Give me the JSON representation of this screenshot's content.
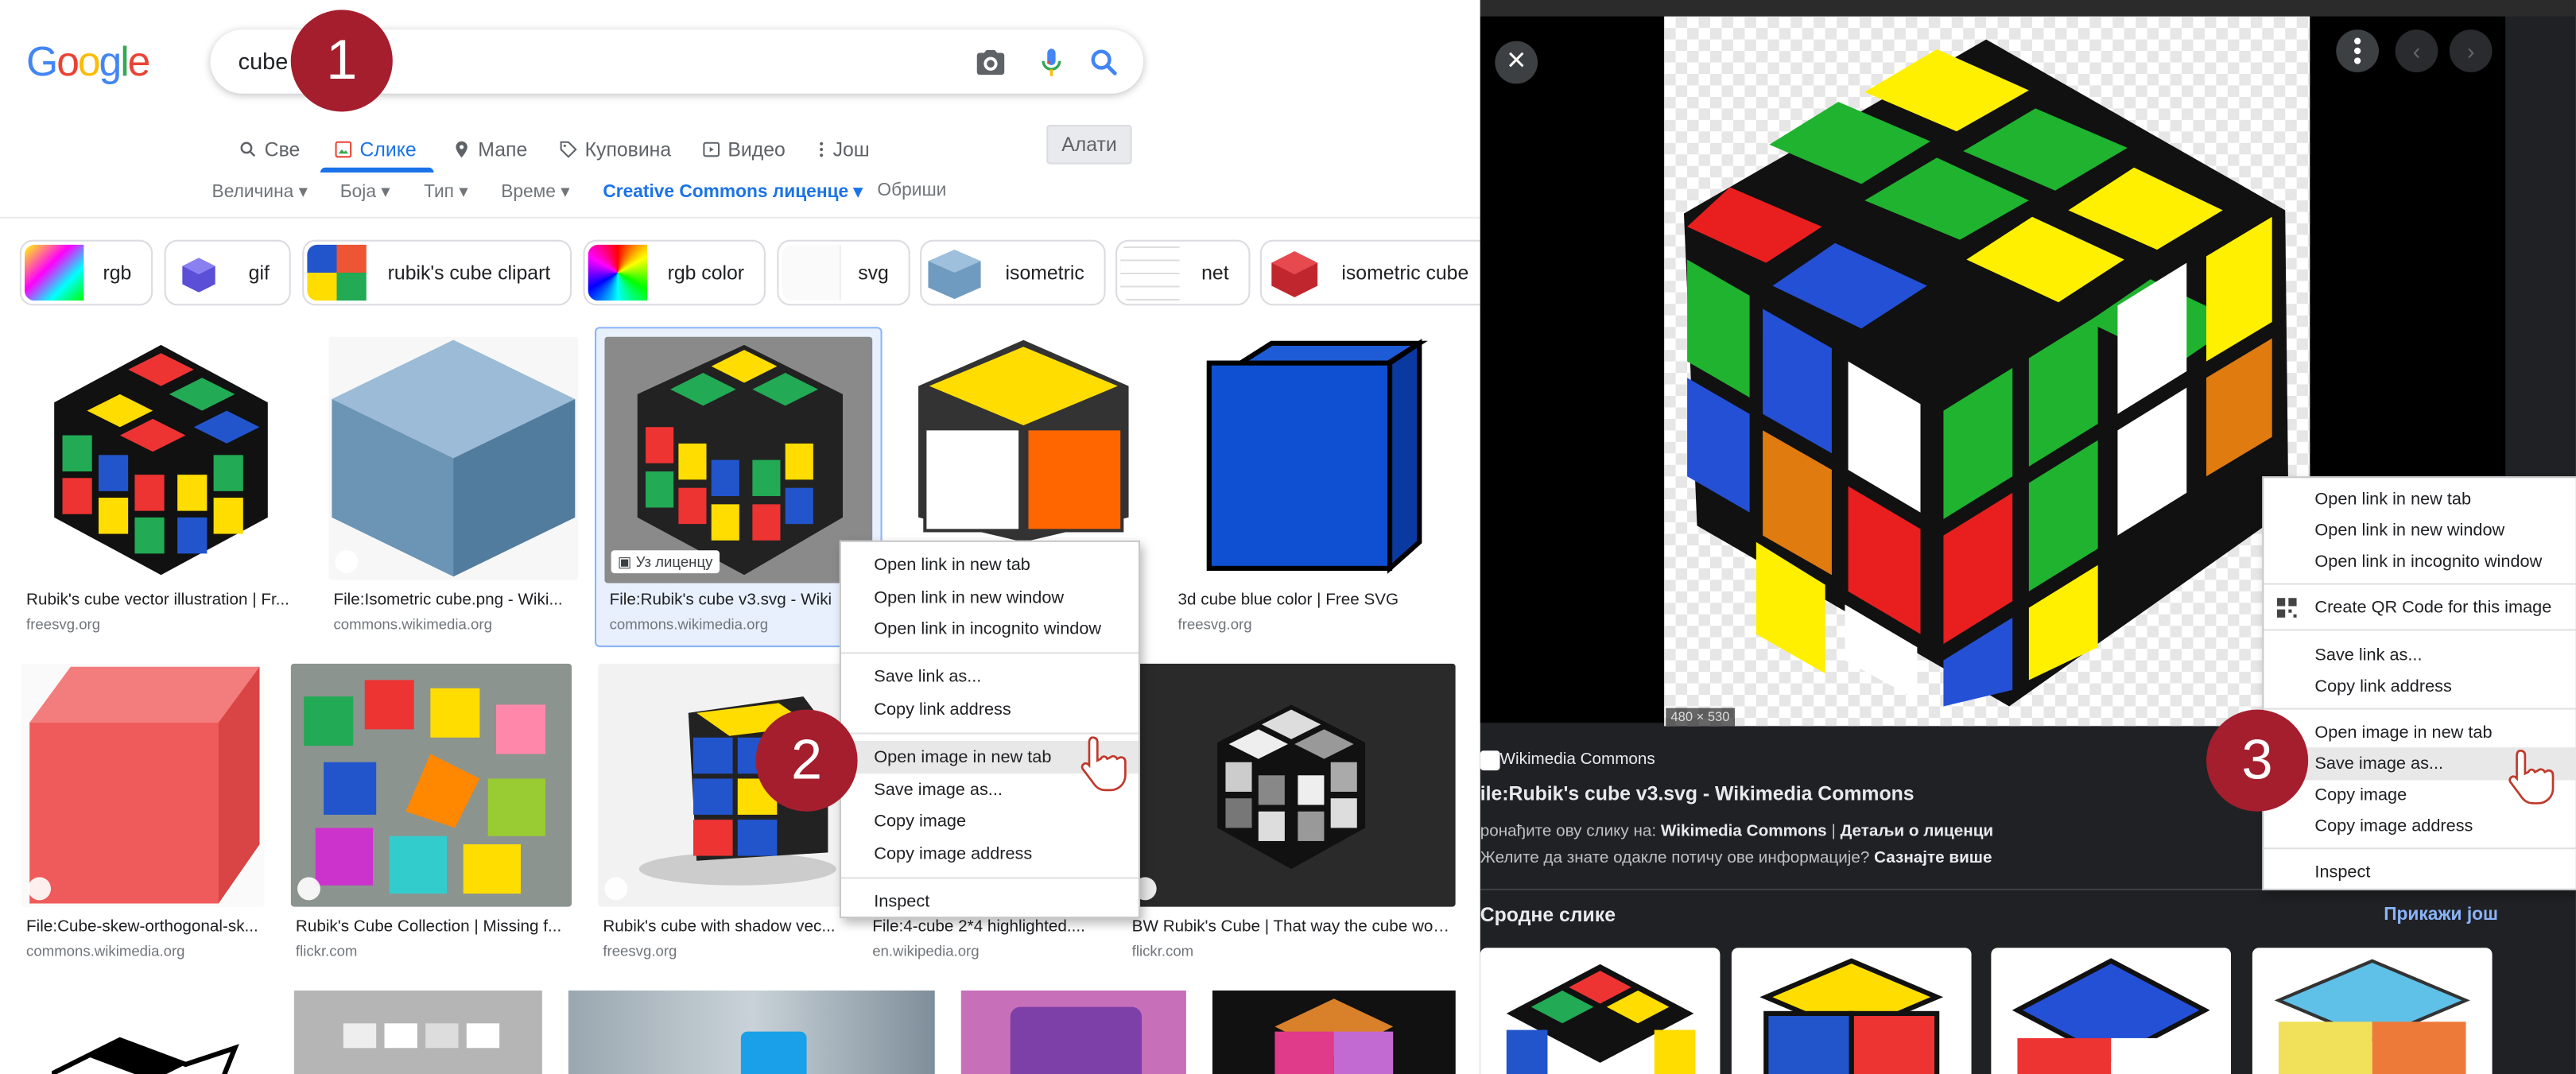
{
  "logo": {
    "letters": [
      "G",
      "o",
      "o",
      "g",
      "l",
      "e"
    ],
    "colors": [
      "#4285F4",
      "#EA4335",
      "#FBBC05",
      "#4285F4",
      "#34A853",
      "#EA4335"
    ]
  },
  "search": {
    "query": "cube"
  },
  "tabs": [
    {
      "label": "Све",
      "icon": "search-icon"
    },
    {
      "label": "Слике",
      "icon": "image-icon",
      "active": true
    },
    {
      "label": "Мапе",
      "icon": "map-pin-icon"
    },
    {
      "label": "Куповина",
      "icon": "tag-icon"
    },
    {
      "label": "Видео",
      "icon": "video-icon"
    },
    {
      "label": "Још",
      "icon": "more-vert-icon"
    }
  ],
  "tools_label": "Алати",
  "filters": [
    "Величина",
    "Боја",
    "Тип",
    "Време",
    "Creative Commons лиценце",
    "Обриши"
  ],
  "chips": [
    "rgb",
    "gif",
    "rubik's cube clipart",
    "rgb color",
    "svg",
    "isometric",
    "net",
    "isometric cube"
  ],
  "results_row1": [
    {
      "caption": "Rubik's cube vector illustration | Fr...",
      "source": "freesvg.org"
    },
    {
      "caption": "File:Isometric cube.png - Wiki...",
      "source": "commons.wikimedia.org"
    },
    {
      "caption": "File:Rubik's cube v3.svg - Wiki",
      "source": "commons.wikimedia.org",
      "license_badge": "Уз лиценцу"
    },
    {
      "caption": "",
      "source": ""
    },
    {
      "caption": "3d cube blue color | Free SVG",
      "source": "freesvg.org"
    }
  ],
  "results_row2": [
    {
      "caption": "File:Cube-skew-orthogonal-sk...",
      "source": "commons.wikimedia.org"
    },
    {
      "caption": "Rubik's Cube Collection | Missing f...",
      "source": "flickr.com"
    },
    {
      "caption": "Rubik's cube with shadow vec...",
      "source": "freesvg.org"
    },
    {
      "caption": "File:4-cube 2*4 highlighted....",
      "source": "en.wikipedia.org"
    },
    {
      "caption": "BW Rubik's Cube | That way the cube wou...",
      "source": "flickr.com"
    }
  ],
  "context_menu_left": {
    "items": [
      "Open link in new tab",
      "Open link in new window",
      "Open link in incognito window",
      "Save link as...",
      "Copy link address",
      "Open image in new tab",
      "Save image as...",
      "Copy image",
      "Copy image address",
      "Inspect"
    ],
    "highlighted": "Open image in new tab"
  },
  "context_menu_right": {
    "items": [
      "Open link in new tab",
      "Open link in new window",
      "Open link in incognito window",
      "Create QR Code for this image",
      "Save link as...",
      "Copy link address",
      "Open image in new tab",
      "Save image as...",
      "Copy image",
      "Copy image address",
      "Inspect"
    ],
    "highlighted": "Save image as..."
  },
  "steps": [
    "1",
    "2",
    "3"
  ],
  "viewer": {
    "dimensions": "480 × 530",
    "site": "Wikimedia Commons",
    "title": "ile:Rubik's cube v3.svg - Wikimedia Commons",
    "found_prefix": "ронађите ову слику на:",
    "found_site": "Wikimedia Commons",
    "found_sep": "|",
    "found_license": "Детаљи о лиценци",
    "question": "Желите да знате одакле потичу ове информације?",
    "learn_more": "Сазнајте више",
    "related": "Сродне слике",
    "show_more": "Прикажи још"
  }
}
